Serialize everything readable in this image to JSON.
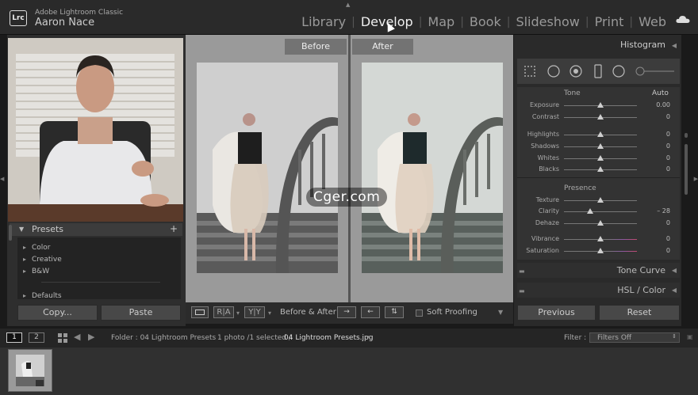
{
  "app": {
    "product": "Adobe Lightroom Classic",
    "logo": "Lrc",
    "user": "Aaron Nace"
  },
  "modules": [
    {
      "label": "Library",
      "active": false
    },
    {
      "label": "Develop",
      "active": true
    },
    {
      "label": "Map",
      "active": false
    },
    {
      "label": "Book",
      "active": false
    },
    {
      "label": "Slideshow",
      "active": false
    },
    {
      "label": "Print",
      "active": false
    },
    {
      "label": "Web",
      "active": false
    }
  ],
  "left": {
    "presets_title": "Presets",
    "presets_add": "+",
    "presets": [
      "Color",
      "Creative",
      "B&W",
      "Defaults"
    ],
    "copy_label": "Copy...",
    "paste_label": "Paste"
  },
  "center": {
    "before_label": "Before",
    "after_label": "After",
    "toolbar": {
      "ra": "R|A",
      "yy": "Y|Y",
      "before_after": "Before & After :",
      "soft_proofing": "Soft Proofing"
    }
  },
  "right": {
    "histogram_title": "Histogram",
    "tone": {
      "title": "Tone",
      "auto": "Auto"
    },
    "tone_sliders": [
      {
        "label": "Exposure",
        "value": "0.00",
        "pos": 0.5
      },
      {
        "label": "Contrast",
        "value": "0",
        "pos": 0.5
      },
      {
        "label": "Highlights",
        "value": "0",
        "pos": 0.5
      },
      {
        "label": "Shadows",
        "value": "0",
        "pos": 0.5
      },
      {
        "label": "Whites",
        "value": "0",
        "pos": 0.5
      },
      {
        "label": "Blacks",
        "value": "0",
        "pos": 0.5
      }
    ],
    "presence": {
      "title": "Presence"
    },
    "presence_sliders": [
      {
        "label": "Texture",
        "value": "",
        "pos": 0.5
      },
      {
        "label": "Clarity",
        "value": "– 28",
        "pos": 0.36
      },
      {
        "label": "Dehaze",
        "value": "0",
        "pos": 0.5
      },
      {
        "label": "Vibrance",
        "value": "0",
        "pos": 0.5
      },
      {
        "label": "Saturation",
        "value": "0",
        "pos": 0.5
      }
    ],
    "tone_curve": "Tone Curve",
    "hsl": "HSL / Color",
    "previous_label": "Previous",
    "reset_label": "Reset"
  },
  "filmbar": {
    "view1": "1",
    "view2": "2",
    "folder": "Folder : 04 Lightroom Presets",
    "count": "1 photo /1 selected /",
    "filename": "04 Lightroom Presets.jpg",
    "filter_label": "Filter :",
    "filter_value": "Filters Off"
  },
  "watermark": "Cger.com",
  "colors": {
    "panel": "#2a2a2a",
    "background": "#1a1a1a",
    "active_text": "#f0f0f0",
    "center_bg": "#9a9a9a"
  }
}
